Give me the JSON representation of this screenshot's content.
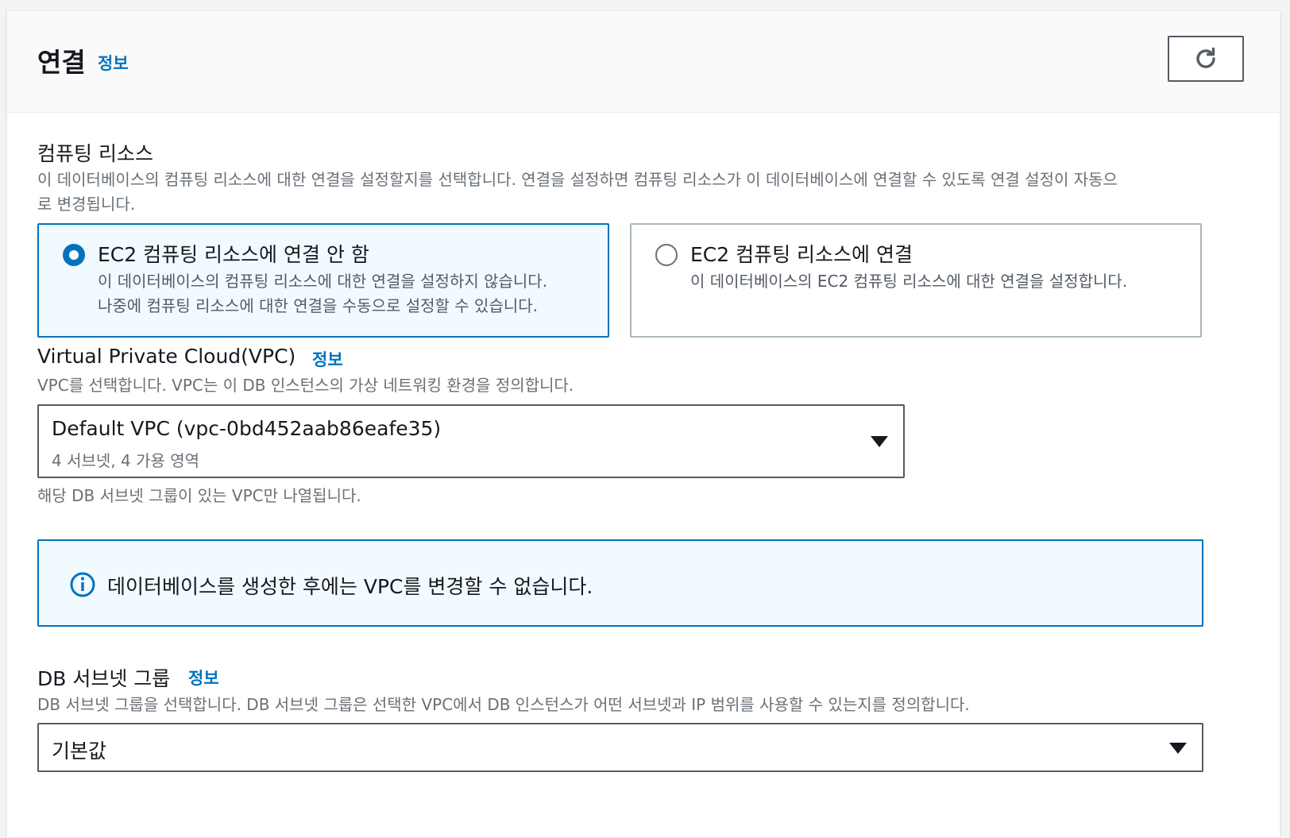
{
  "header": {
    "title": "연결",
    "info": "정보",
    "refresh_icon": "refresh-icon"
  },
  "compute": {
    "label": "컴퓨팅 리소스",
    "desc_line1": "이 데이터베이스의 컴퓨팅 리소스에 대한 연결을 설정할지를 선택합니다. 연결을 설정하면 컴퓨팅 리소스가 이 데이터베이스에 연결할 수 있도록 연결 설정이 자동으",
    "desc_line2": "로 변경됩니다.",
    "options": [
      {
        "title": "EC2 컴퓨팅 리소스에 연결 안 함",
        "desc_line1": "이 데이터베이스의 컴퓨팅 리소스에 대한 연결을 설정하지 않습니다.",
        "desc_line2": "나중에 컴퓨팅 리소스에 대한 연결을 수동으로 설정할 수 있습니다.",
        "selected": true
      },
      {
        "title": "EC2 컴퓨팅 리소스에 연결",
        "desc_line1": "이 데이터베이스의 EC2 컴퓨팅 리소스에 대한 연결을 설정합니다.",
        "desc_line2": "",
        "selected": false
      }
    ]
  },
  "vpc": {
    "label": "Virtual Private Cloud(VPC)",
    "info": "정보",
    "desc": "VPC를 선택합니다. VPC는 이 DB 인스턴스의 가상 네트워킹 환경을 정의합니다.",
    "selected_value": "Default VPC (vpc-0bd452aab86eafe35)",
    "selected_sub": "4 서브넷, 4 가용 영역",
    "hint": "해당 DB 서브넷 그룹이 있는 VPC만 나열됩니다."
  },
  "alert": {
    "text": "데이터베이스를 생성한 후에는 VPC를 변경할 수 없습니다.",
    "icon": "info-icon",
    "color": "#0073bb"
  },
  "subnet": {
    "label": "DB 서브넷 그룹",
    "info": "정보",
    "desc": "DB 서브넷 그룹을 선택합니다. DB 서브넷 그룹은 선택한 VPC에서 DB 인스턴스가 어떤 서브넷과 IP 범위를 사용할 수 있는지를 정의합니다.",
    "selected_value": "기본값"
  },
  "colors": {
    "accent": "#0073bb",
    "selected_bg": "#f1faff",
    "text": "#16191f",
    "muted": "#687078"
  }
}
